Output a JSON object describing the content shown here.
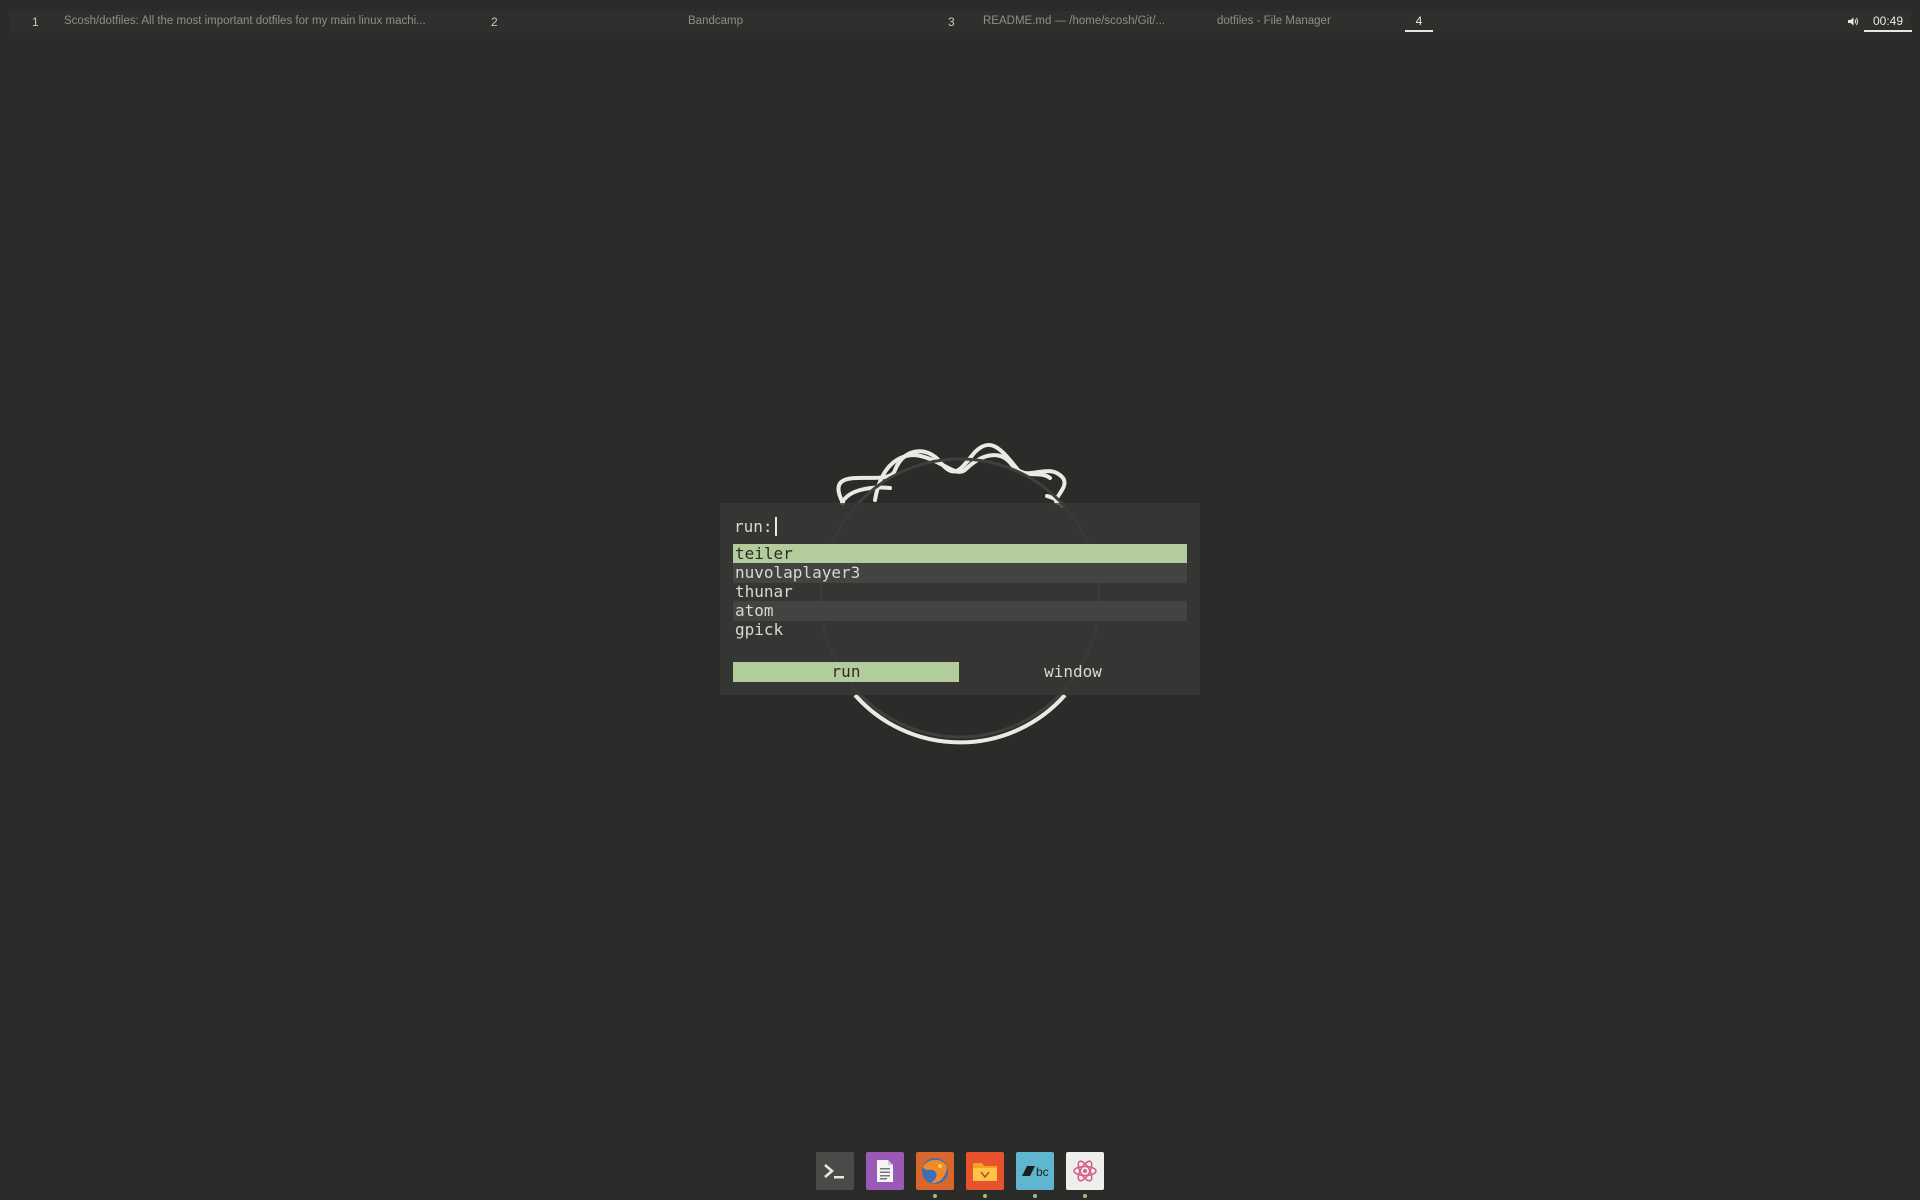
{
  "panel": {
    "workspaces": [
      {
        "number": "1",
        "title": "Scosh/dotfiles: All the most important dotfiles for my main linux machi..."
      },
      {
        "number": "2",
        "title": "Bandcamp"
      },
      {
        "number": "3",
        "title": "README.md — /home/scosh/Git/..."
      },
      {
        "number": "",
        "title": "dotfiles - File Manager"
      }
    ],
    "active_workspace": "4",
    "clock": "00:49",
    "volume_icon": "volume-icon"
  },
  "launcher": {
    "prompt": "run:",
    "entries": [
      "teiler",
      "nuvolaplayer3",
      "thunar",
      "atom",
      "gpick"
    ],
    "selected_entry": "teiler",
    "modes": [
      "run",
      "window"
    ],
    "selected_mode": "run"
  },
  "dock": {
    "apps": [
      {
        "name": "terminal-icon",
        "color": "#4a4a48"
      },
      {
        "name": "text-editor-icon",
        "color": "#9b59b6"
      },
      {
        "name": "firefox-icon",
        "color": "#e8662c"
      },
      {
        "name": "file-manager-icon",
        "color": "#e8522c"
      },
      {
        "name": "bandcamp-icon",
        "color": "#5fb6cf"
      },
      {
        "name": "atom-icon",
        "color": "#efefef"
      }
    ]
  },
  "colors": {
    "background": "#2b2b29",
    "accent": "#b3cc9c",
    "launcher_bg": "#383836"
  }
}
